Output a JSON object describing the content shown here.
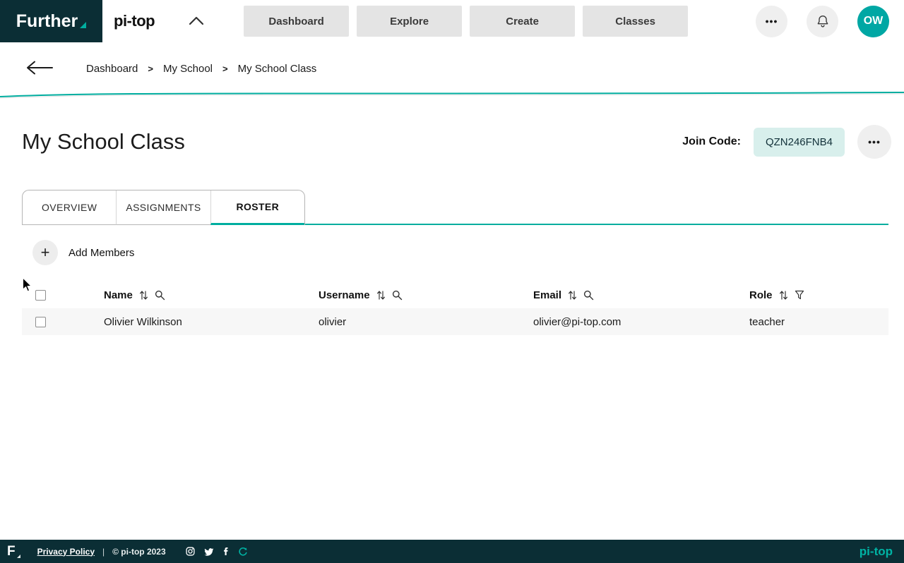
{
  "colors": {
    "dark_navy": "#0b2e35",
    "teal_accent": "#00ad9f",
    "avatar_teal": "#00a7a4",
    "join_pill_bg": "#d8efec",
    "nav_button_bg": "#e4e4e4",
    "row_stripe": "#f7f7f7"
  },
  "header": {
    "brand": "Further",
    "logo": "pi-top",
    "nav": [
      {
        "label": "Dashboard"
      },
      {
        "label": "Explore"
      },
      {
        "label": "Create"
      },
      {
        "label": "Classes"
      }
    ],
    "more_icon": "•••",
    "avatar_initials": "OW"
  },
  "breadcrumb": {
    "items": [
      "Dashboard",
      "My School",
      "My School Class"
    ],
    "separator": ">"
  },
  "page": {
    "title": "My School Class",
    "join_code_label": "Join Code:",
    "join_code_value": "QZN246FNB4",
    "more_icon": "•••"
  },
  "tabs": [
    {
      "label": "OVERVIEW"
    },
    {
      "label": "ASSIGNMENTS"
    },
    {
      "label": "ROSTER"
    }
  ],
  "roster": {
    "add_members_label": "Add Members",
    "plus_icon": "+",
    "columns": [
      {
        "label": "Name"
      },
      {
        "label": "Username"
      },
      {
        "label": "Email"
      },
      {
        "label": "Role"
      }
    ],
    "rows": [
      {
        "name": "Olivier Wilkinson",
        "username": "olivier",
        "email": "olivier@pi-top.com",
        "role": "teacher"
      }
    ]
  },
  "footer": {
    "brand_mark": "F",
    "privacy_policy": "Privacy Policy",
    "divider": "|",
    "copyright": "© pi-top 2023",
    "brand": "pi-top"
  }
}
